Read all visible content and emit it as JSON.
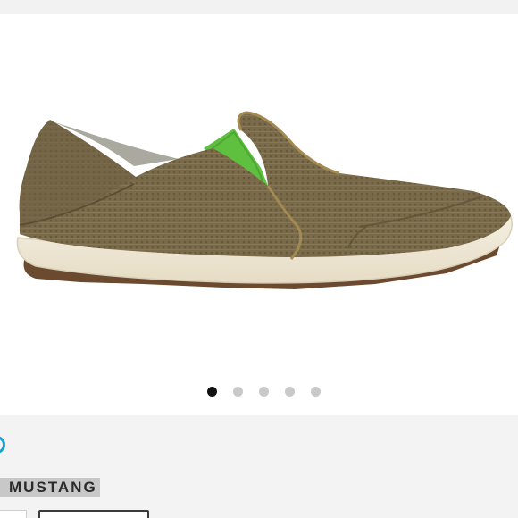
{
  "product": {
    "color_name": "MUSTANG",
    "image_icon": "slip-on-shoe-icon"
  },
  "gallery": {
    "active_index": 0,
    "dots": [
      {
        "label": "image-1"
      },
      {
        "label": "image-2"
      },
      {
        "label": "image-3"
      },
      {
        "label": "image-4"
      },
      {
        "label": "image-5"
      }
    ]
  },
  "colors": {
    "swatch_ring": "#1aa0d8",
    "shoe_mesh": "#7b6c4c",
    "shoe_green": "#5fbf3f",
    "sole": "#efe9d8"
  }
}
